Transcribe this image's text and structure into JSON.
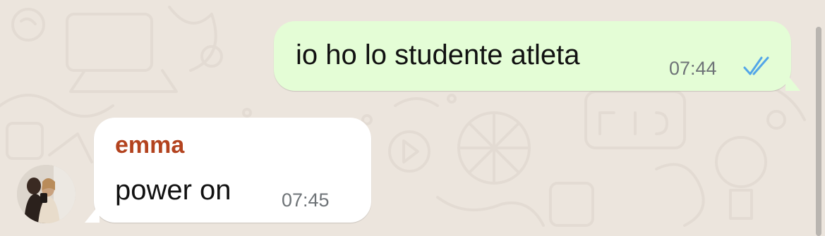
{
  "messages": [
    {
      "direction": "outgoing",
      "text": "io ho lo studente atleta",
      "time": "07:44",
      "status_icon": "double-check-read-icon",
      "bubble_color": "#e4fdd6",
      "tick_color": "#53a6e8"
    },
    {
      "direction": "incoming",
      "sender": "emma",
      "sender_color": "#b3431f",
      "text": "power on",
      "time": "07:45",
      "bubble_color": "#ffffff",
      "avatar": "profile-photo"
    }
  ],
  "colors": {
    "chat_background": "#ece5dd",
    "timestamp": "#6e7377"
  }
}
